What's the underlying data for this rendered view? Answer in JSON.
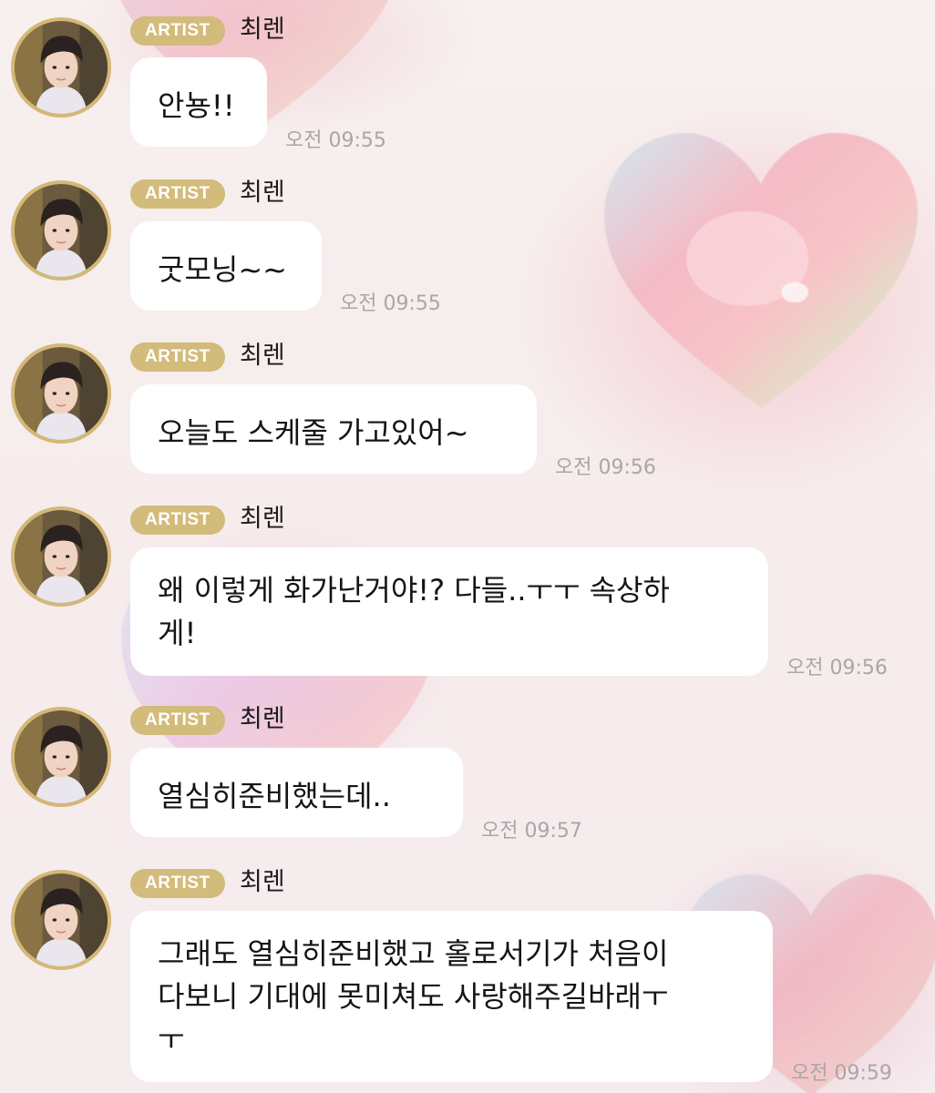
{
  "artist_badge": "ARTIST",
  "messages": [
    {
      "sender": "최렌",
      "lines": [
        "안뇽!!"
      ],
      "time": "오전 09:55"
    },
    {
      "sender": "최렌",
      "lines": [
        "굿모닝~~"
      ],
      "time": "오전 09:55"
    },
    {
      "sender": "최렌",
      "lines": [
        "오늘도 스케줄 가고있어~"
      ],
      "time": "오전 09:56"
    },
    {
      "sender": "최렌",
      "lines": [
        "왜 이렇게 화가난거야!? 다들..ㅜㅜ 속상하",
        "게!"
      ],
      "time": "오전 09:56"
    },
    {
      "sender": "최렌",
      "lines": [
        "열심히준비했는데.."
      ],
      "time": "오전 09:57"
    },
    {
      "sender": "최렌",
      "lines": [
        "그래도 열심히준비했고 홀로서기가 처음이",
        "다보니 기대에 못미쳐도 사랑해주길바래ㅜ",
        "ㅜ"
      ],
      "time": "오전 09:59"
    }
  ],
  "colors": {
    "badge": "#d2bb7b",
    "avatar_ring": "#d4b876",
    "bubble": "#ffffff",
    "timestamp": "#aaa6a6"
  },
  "icons": {
    "avatar": "artist-avatar-photo",
    "background": "iridescent-heart-icon"
  }
}
